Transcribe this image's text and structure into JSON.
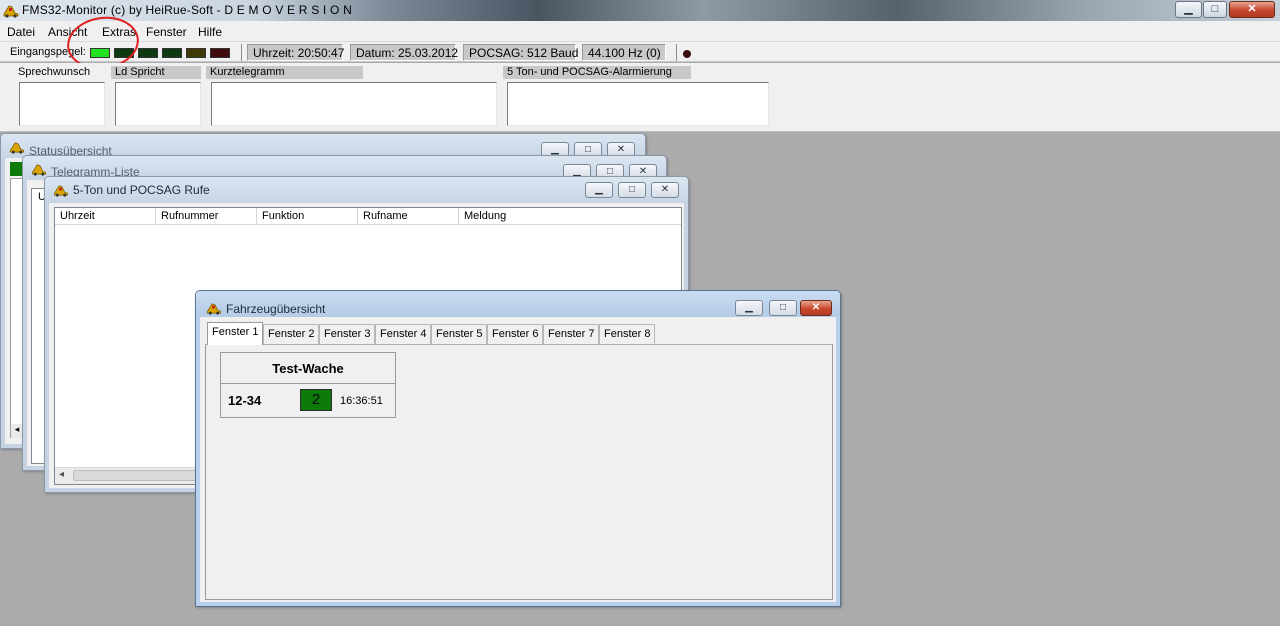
{
  "app": {
    "title": "FMS32-Monitor (c) by HeiRue-Soft - D E M O V E R S I O N",
    "caption_min": "▁",
    "caption_max": "□",
    "caption_close": "✕"
  },
  "menu": [
    "Datei",
    "Ansicht",
    "Extras",
    "Fenster",
    "Hilfe"
  ],
  "statusbar": {
    "level_label": "Eingangspegel:",
    "level_leds": [
      "#22e222",
      "#0f3a0f",
      "#0f3a0f",
      "#0f3a0f",
      "#3f3a08",
      "#3f0b0b"
    ],
    "time": "Uhrzeit: 20:50:47",
    "date": "Datum:  25.03.2012",
    "pocsag": "POCSAG: 512 Baud",
    "freq": "44.100 Hz (0)"
  },
  "panels": [
    {
      "label": "Sprechwunsch"
    },
    {
      "label": "Ld Spricht"
    },
    {
      "label": "Kurztelegramm"
    },
    {
      "label": "5 Ton- und POCSAG-Alarmierung"
    }
  ],
  "windows": {
    "status": {
      "title": "Statusübersicht"
    },
    "telegram": {
      "title": "Telegramm-Liste",
      "col_first": "U"
    },
    "calls": {
      "title": "5-Ton und POCSAG Rufe",
      "columns": [
        "Uhrzeit",
        "Rufnummer",
        "Funktion",
        "Rufname",
        "Meldung"
      ],
      "scroll_left": "◂"
    },
    "vehicles": {
      "title": "Fahrzeugübersicht",
      "tabs": [
        "Fenster 1",
        "Fenster 2",
        "Fenster 3",
        "Fenster 4",
        "Fenster 5",
        "Fenster 6",
        "Fenster 7",
        "Fenster 8"
      ],
      "station": "Test-Wache",
      "vehicle_id": "12-34",
      "status": "2",
      "status_color": "#0b7a0b",
      "time": "16:36:51"
    }
  },
  "icons": {
    "app": "fire-truck-icon"
  },
  "colors": {
    "desktop": "#ababab",
    "menubar": "#f0f0f0"
  }
}
